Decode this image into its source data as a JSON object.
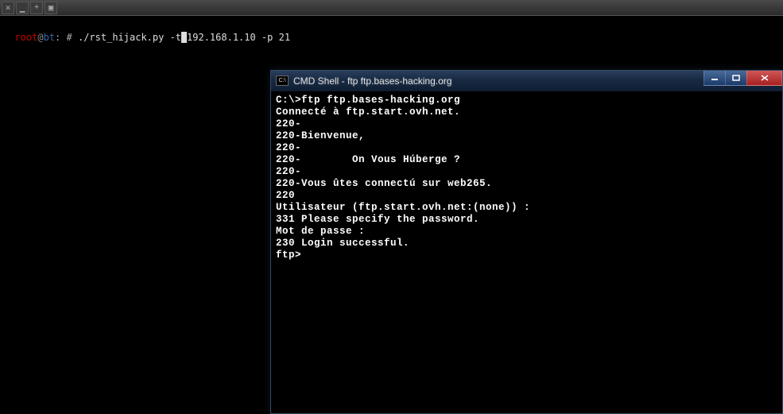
{
  "linux": {
    "toolbar": {
      "close_glyph": "✕",
      "min_glyph": "▁",
      "new_glyph": "+",
      "copy_glyph": "▣"
    },
    "prompt": {
      "user": "root",
      "at": "@",
      "host": "bt",
      "colon": ":",
      "hash": " # ",
      "cmd_before_cursor": "./rst_hijack.py -t",
      "cursor": " ",
      "cmd_after_cursor": "192.168.1.10 -p 21"
    }
  },
  "cmd": {
    "icon_text": "C:\\",
    "title": "CMD Shell - ftp  ftp.bases-hacking.org",
    "lines": [
      "",
      "C:\\>ftp ftp.bases-hacking.org",
      "Connecté à ftp.start.ovh.net.",
      "220-",
      "220-Bienvenue,",
      "220-",
      "220-        On Vous Húberge ?",
      "220-",
      "220-Vous ûtes connectú sur web265.",
      "220",
      "Utilisateur (ftp.start.ovh.net:(none)) :",
      "331 Please specify the password.",
      "Mot de passe :",
      "230 Login successful.",
      "ftp>"
    ]
  }
}
